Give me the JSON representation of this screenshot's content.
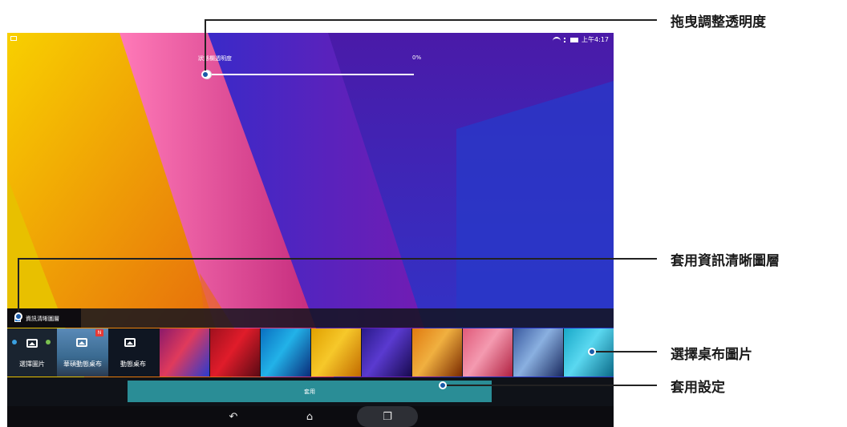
{
  "status_bar": {
    "time": "上午4:17"
  },
  "transparency": {
    "label": "狀態欄透明度",
    "value": "0%"
  },
  "info_layer": {
    "label": "資訊清晰圖層",
    "checked": true
  },
  "wallpaper_options": [
    {
      "label": "選擇圖片",
      "icon": "image-picker-icon"
    },
    {
      "label": "華碩動態桌布",
      "icon": "asus-live-wallpaper-icon",
      "badge": "N"
    },
    {
      "label": "動態桌布",
      "icon": "live-wallpaper-icon"
    }
  ],
  "wallpapers": [
    {
      "colors": [
        "#8b1a6b",
        "#e03a5c",
        "#2a3bd0"
      ]
    },
    {
      "colors": [
        "#a0101e",
        "#e01c2a",
        "#5a0a14"
      ]
    },
    {
      "colors": [
        "#0a6fc0",
        "#22b2e8",
        "#0a2c7a"
      ]
    },
    {
      "colors": [
        "#e0a000",
        "#f6c82a",
        "#c26a00"
      ]
    },
    {
      "colors": [
        "#2a1a8a",
        "#5a3ad0",
        "#180a50"
      ]
    },
    {
      "colors": [
        "#e07a10",
        "#f0b040",
        "#7a2a00"
      ]
    },
    {
      "colors": [
        "#e05a7a",
        "#f49ab0",
        "#b02040"
      ]
    },
    {
      "colors": [
        "#3a5aa0",
        "#8ab0e0",
        "#1a2a60"
      ]
    },
    {
      "colors": [
        "#18a8c8",
        "#5ad8f0",
        "#0a6a88"
      ]
    }
  ],
  "apply_button": {
    "label": "套用"
  },
  "nav": {
    "back": "↶",
    "home": "⌂",
    "recent": "❐"
  },
  "callouts": [
    {
      "text": "拖曳調整透明度"
    },
    {
      "text": "套用資訊清晰圖層"
    },
    {
      "text": "選擇桌布圖片"
    },
    {
      "text": "套用設定"
    }
  ],
  "colors": {
    "accent": "#2a8d96",
    "callout_dot": "#1a5aa8"
  }
}
